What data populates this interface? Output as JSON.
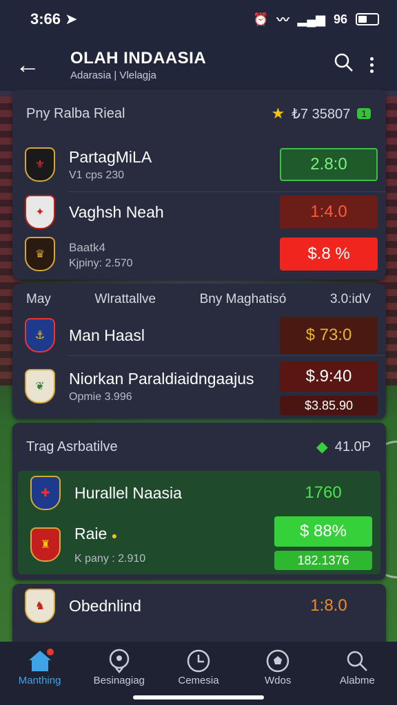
{
  "status": {
    "time": "3:66",
    "signal": "96"
  },
  "header": {
    "title": "OLAH INDAASIA",
    "subtitle": "Adarasia | Vlelagja"
  },
  "cards": [
    {
      "head": {
        "left": "Pny Ralba Rieal",
        "right": "₺7 35807",
        "badge": "1"
      },
      "rows": [
        {
          "name": "PartagMiLA",
          "sub": "V1 cps 230",
          "odd": "2.8:0"
        },
        {
          "name": "Vaghsh Neah",
          "sub": "",
          "odd": "1:4.0"
        },
        {
          "name": "",
          "sub": "Baatk4",
          "sub2": "Kjpiny: 2.570",
          "odd": "$.8 %"
        }
      ]
    },
    {
      "head": {
        "left": "May",
        "mid1": "Wlrattallve",
        "mid2": "Bny Maghatisó",
        "right": "3.0:idV"
      },
      "rows": [
        {
          "name": "Man Haasl",
          "odd": "$ 73:0"
        },
        {
          "name": "Niorkan Paraldiaidngaajus",
          "sub": "Opmie 3.996",
          "odd": "$.9:40",
          "odd2": "$3.85.90"
        }
      ]
    },
    {
      "head": {
        "left": "Trag Asrbatilve",
        "right": "41.0P"
      },
      "rows": [
        {
          "name": "Hurallel Naasia",
          "odd": "1760"
        },
        {
          "name": "Raie",
          "sub": "K pany : 2.910",
          "odd": "$ 88%",
          "odd2": "182.1376"
        }
      ]
    },
    {
      "rows": [
        {
          "name": "Obednlind",
          "odd": "1:8.0"
        }
      ]
    }
  ],
  "tabs": [
    {
      "label": "Manthing",
      "icon": "home-icon"
    },
    {
      "label": "Besinagiag",
      "icon": "pin-icon"
    },
    {
      "label": "Cemesia",
      "icon": "clock-icon"
    },
    {
      "label": "Wdos",
      "icon": "ball-icon"
    },
    {
      "label": "Alabme",
      "icon": "search-icon"
    }
  ],
  "colors": {
    "green_dark": "#1f5a2a",
    "green_bright": "#36d13a",
    "red_dark": "#6b1d18",
    "red_bright": "#f0261e",
    "active_tab": "#3fa3e8"
  }
}
